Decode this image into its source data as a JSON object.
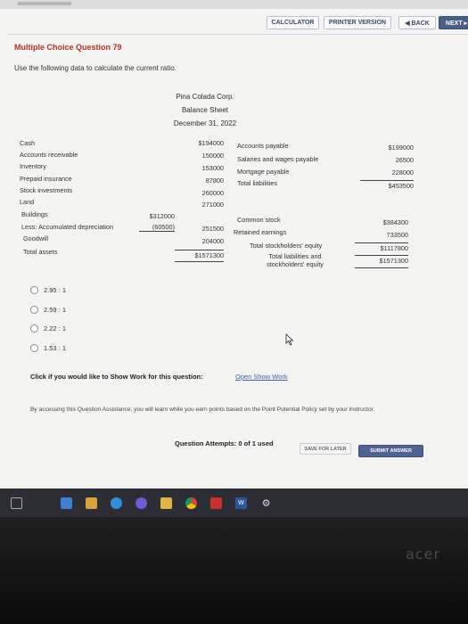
{
  "toolbar": {
    "calculator": "CALCULATOR",
    "printer_version": "PRINTER VERSION",
    "back": "◀ BACK",
    "next": "NEXT ▸"
  },
  "question": {
    "title": "Multiple Choice Question 79",
    "prompt": "Use the following data to calculate the current ratio."
  },
  "balance_sheet": {
    "company": "Pina Colada Corp.",
    "statement": "Balance Sheet",
    "date": "December 31, 2022",
    "assets": [
      {
        "label": "Cash",
        "amount": "$194000"
      },
      {
        "label": "Accounts receivable",
        "amount": "150000"
      },
      {
        "label": "Inventory",
        "amount": "153000"
      },
      {
        "label": "Prepaid insurance",
        "amount": "87800"
      },
      {
        "label": "Stock investments",
        "amount": "260000"
      },
      {
        "label": "Land",
        "amount": "271000"
      },
      {
        "label": "Buildings",
        "sub": "$312000"
      },
      {
        "label": "Less: Accumulated depreciation",
        "sub": "(60500)",
        "amount": "251500"
      },
      {
        "label": "Goodwill",
        "amount": "204000"
      },
      {
        "label": "Total assets",
        "amount": "$1571300"
      }
    ],
    "liabilities": [
      {
        "label": "Accounts payable",
        "amount": "$199000"
      },
      {
        "label": "Salaries and wages payable",
        "amount": "26500"
      },
      {
        "label": "Mortgage payable",
        "amount": "228000"
      },
      {
        "label": "Total liabilities",
        "amount": "$453500"
      }
    ],
    "equity": [
      {
        "label": "Common stock",
        "amount": "$384300"
      },
      {
        "label": "Retained earnings",
        "amount": "733500"
      },
      {
        "label": "Total stockholders' equity",
        "amount": "$1117800"
      },
      {
        "label": "Total liabilities and",
        "label2": "stockholders' equity",
        "amount": "$1571300"
      }
    ]
  },
  "options": [
    "2.95 : 1",
    "2.59 : 1",
    "2.22 : 1",
    "1.53 : 1"
  ],
  "show_work": {
    "prompt": "Click if you would like to Show Work for this question:",
    "link": "Open Show Work"
  },
  "assistance": "By accessing this Question Assistance, you will learn while you earn points based on the Point Potential Policy set by your instructor.",
  "attempts": "Question Attempts: 0 of 1 used",
  "save_later": "SAVE FOR LATER",
  "submit": "SUBMIT ANSWER",
  "brand": "acer",
  "taskbar_icons": [
    "start-icon",
    "file-explorer-icon",
    "store-icon",
    "edge-icon",
    "media-icon",
    "folder-icon",
    "chrome-icon",
    "pdf-icon",
    "word-icon",
    "settings-icon"
  ]
}
